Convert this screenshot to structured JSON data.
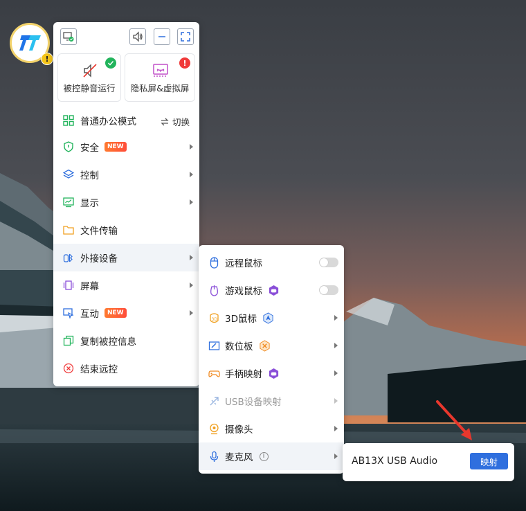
{
  "toolbar": {
    "icons": [
      "monitor-check-icon",
      "speaker-icon",
      "minimize-icon",
      "fullscreen-icon"
    ]
  },
  "cards": [
    {
      "label": "被控静音运行",
      "icon": "mute-speaker-icon",
      "status": "ok"
    },
    {
      "label": "隐私屏&虚拟屏",
      "icon": "privacy-screen-icon",
      "status": "alert"
    }
  ],
  "menu": {
    "items": [
      {
        "label": "普通办公模式",
        "icon": "grid-icon",
        "action": "切换"
      },
      {
        "label": "安全",
        "icon": "shield-icon",
        "badge": "NEW"
      },
      {
        "label": "控制",
        "icon": "layers-icon"
      },
      {
        "label": "显示",
        "icon": "display-chart-icon"
      },
      {
        "label": "文件传输",
        "icon": "folder-icon"
      },
      {
        "label": "外接设备",
        "icon": "external-device-icon"
      },
      {
        "label": "屏幕",
        "icon": "screen-icon"
      },
      {
        "label": "互动",
        "icon": "interact-icon",
        "badge": "NEW"
      },
      {
        "label": "复制被控信息",
        "icon": "copy-icon"
      },
      {
        "label": "结束远控",
        "icon": "close-circle-icon"
      }
    ]
  },
  "submenu": {
    "items": [
      {
        "label": "远程鼠标",
        "icon": "mouse-icon",
        "toggle": "off"
      },
      {
        "label": "游戏鼠标",
        "icon": "game-mouse-icon",
        "toggle": "off"
      },
      {
        "label": "3D鼠标",
        "icon": "3d-mouse-icon"
      },
      {
        "label": "数位板",
        "icon": "tablet-icon"
      },
      {
        "label": "手柄映射",
        "icon": "gamepad-icon"
      },
      {
        "label": "USB设备映射",
        "icon": "usb-icon",
        "disabled": true
      },
      {
        "label": "摄像头",
        "icon": "camera-icon"
      },
      {
        "label": "麦克风",
        "icon": "microphone-icon",
        "info": "i"
      }
    ]
  },
  "device_popup": {
    "device_name": "AB13X USB Audio",
    "button_label": "映射"
  },
  "colors": {
    "accent": "#2f6fde",
    "success": "#22b45c",
    "alert": "#f03a3a",
    "new_badge": "#ff5a33",
    "pointer_arrow": "#e8372d"
  }
}
